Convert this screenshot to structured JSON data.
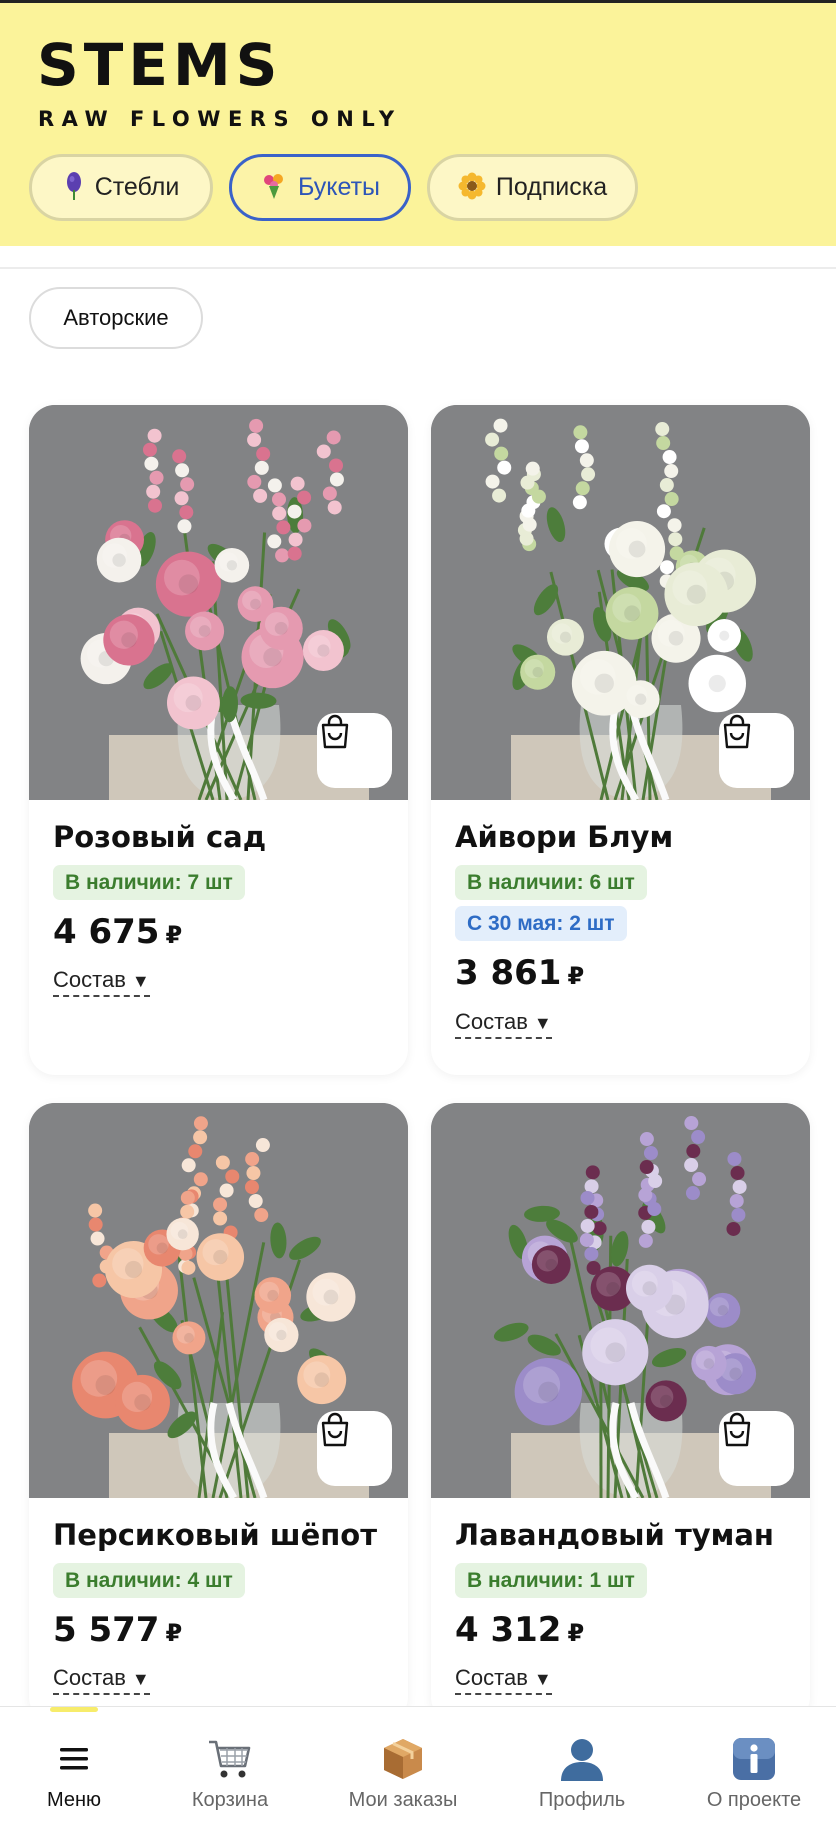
{
  "brand": {
    "title": "STEMS",
    "subtitle": "RAW FLOWERS ONLY"
  },
  "tabs": [
    {
      "label": "Стебли",
      "icon": "hyacinth-icon",
      "active": false
    },
    {
      "label": "Букеты",
      "icon": "bouquet-icon",
      "active": true
    },
    {
      "label": "Подписка",
      "icon": "sunflower-icon",
      "active": false
    }
  ],
  "filter_chip": {
    "label": "Авторские"
  },
  "products": [
    {
      "name": "Розовый сад",
      "badges": [
        {
          "text": "В наличии: 7 шт",
          "kind": "green"
        }
      ],
      "price": "4 675",
      "currency": "₽",
      "composition": "Состав",
      "palette": [
        "#e59ab0",
        "#f2c3cf",
        "#d9738f",
        "#f4f1ec"
      ]
    },
    {
      "name": "Айвори Блум",
      "badges": [
        {
          "text": "В наличии: 6 шт",
          "kind": "green"
        },
        {
          "text": "С 30 мая: 2 шт",
          "kind": "blue"
        }
      ],
      "price": "3 861",
      "currency": "₽",
      "composition": "Состав",
      "palette": [
        "#f4f3ea",
        "#e8ecd6",
        "#c4d8a0",
        "#ffffff"
      ]
    },
    {
      "name": "Персиковый шёпот",
      "badges": [
        {
          "text": "В наличии: 4 шт",
          "kind": "green"
        }
      ],
      "price": "5 577",
      "currency": "₽",
      "composition": "Состав",
      "palette": [
        "#f0a48a",
        "#f6c6a6",
        "#e8876f",
        "#f7e6d8"
      ]
    },
    {
      "name": "Лавандовый туман",
      "badges": [
        {
          "text": "В наличии: 1 шт",
          "kind": "green"
        }
      ],
      "price": "4 312",
      "currency": "₽",
      "composition": "Состав",
      "palette": [
        "#b7a3d6",
        "#9c8cc9",
        "#6b2d4f",
        "#d9cfe8"
      ]
    }
  ],
  "bottom_nav": [
    {
      "label": "Меню",
      "icon": "menu-icon",
      "active": true
    },
    {
      "label": "Корзина",
      "icon": "shopping-cart-icon",
      "active": false
    },
    {
      "label": "Мои заказы",
      "icon": "package-icon",
      "active": false
    },
    {
      "label": "Профиль",
      "icon": "profile-icon",
      "active": false
    },
    {
      "label": "О проекте",
      "icon": "info-icon",
      "active": false
    }
  ],
  "colors": {
    "header_bg": "#fbf39a",
    "active_tab_border": "#3a62c9",
    "in_stock": "#3b7d2e",
    "preorder": "#2e6cc5"
  }
}
